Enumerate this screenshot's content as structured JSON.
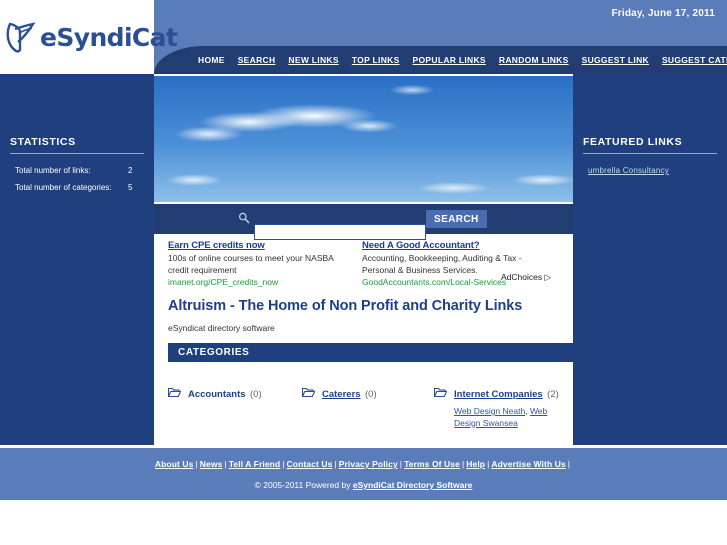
{
  "header": {
    "logo_text": "eSyndiCat",
    "logo_icon": "esyndicat-leaf-logo",
    "date": "Friday, June 17, 2011",
    "nav": [
      {
        "label": "HOME",
        "underline": false
      },
      {
        "label": "SEARCH",
        "underline": true
      },
      {
        "label": "NEW LINKS",
        "underline": true
      },
      {
        "label": "TOP LINKS",
        "underline": true
      },
      {
        "label": "POPULAR LINKS",
        "underline": true
      },
      {
        "label": "RANDOM LINKS",
        "underline": true
      },
      {
        "label": "SUGGEST LINK",
        "underline": true
      },
      {
        "label": "SUGGEST CATEGORY",
        "underline": true
      }
    ]
  },
  "banner": {
    "alt": "blue sky with clouds banner"
  },
  "sidebar_left": {
    "title": "STATISTICS",
    "stats": [
      {
        "label": "Total number of links:",
        "value": "2"
      },
      {
        "label": "Total number of categories:",
        "value": "5"
      }
    ]
  },
  "sidebar_right": {
    "title": "FEATURED LINKS",
    "links": [
      {
        "label": "umbrella Consultancy"
      }
    ]
  },
  "search": {
    "icon": "magnifier-icon",
    "value": "",
    "placeholder": "",
    "button_label": "SEARCH"
  },
  "ads": {
    "adchoices_label": "AdChoices",
    "items": [
      {
        "title": "Earn CPE credits now",
        "body": "100s of online courses to meet your NASBA credit requirement",
        "url": "imanet.org/CPE_credits_now"
      },
      {
        "title": "Need A Good Accountant?",
        "body": "Accounting, Bookkeeping, Auditing & Tax - Personal & Business Services.",
        "url": "GoodAccountants.com/Local-Services"
      }
    ]
  },
  "main": {
    "title": "Altruism - The Home of Non Profit and Charity Links",
    "subtitle": "eSyndicat directory software",
    "categories_heading": "CATEGORIES",
    "categories": [
      {
        "name": "Accountants",
        "count": "(0)",
        "is_link": false,
        "children": []
      },
      {
        "name": "Caterers",
        "count": "(0)",
        "is_link": true,
        "children": []
      },
      {
        "name": "Internet Companies",
        "count": "(2)",
        "is_link": true,
        "children": [
          "Web Design Neath",
          "Web Design Swansea"
        ]
      }
    ]
  },
  "footer": {
    "links": [
      "About Us",
      "News",
      "Tell A Friend",
      "Contact Us",
      "Privacy Policy",
      "Terms Of Use",
      "Help",
      "Advertise With Us"
    ],
    "copyright_prefix": "© 2005-2011 Powered by ",
    "copyright_link": "eSyndiCat Directory Software"
  },
  "colors": {
    "navy": "#1f3f7e",
    "nav_strip": "#223d72",
    "header_blue": "#5a7cb8",
    "link_blue": "#1f3f8e",
    "ad_green": "#1a9a38"
  }
}
